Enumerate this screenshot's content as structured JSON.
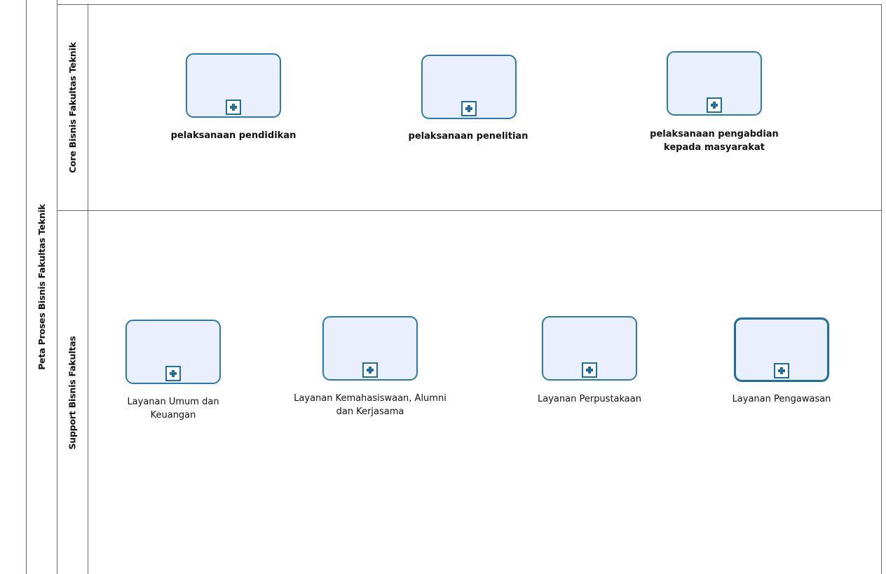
{
  "pool": {
    "title": "Peta Proses Bisnis Fakultas Teknik"
  },
  "lanes": [
    {
      "label": "Core Bisnis Fakultas Teknik",
      "tasks": [
        {
          "label_lines": [
            "pelaksanaan pendidikan"
          ]
        },
        {
          "label_lines": [
            "pelaksanaan penelitian"
          ]
        },
        {
          "label_lines": [
            "pelaksanaan pengabdian",
            "kepada masyarakat"
          ]
        }
      ]
    },
    {
      "label": "Support Bisnis Fakultas",
      "tasks": [
        {
          "label_lines": [
            "Layanan Umum dan",
            "Keuangan"
          ]
        },
        {
          "label_lines": [
            "Layanan Kemahasiswaan, Alumni",
            "dan Kerjasama"
          ]
        },
        {
          "label_lines": [
            "Layanan Perpustakaan"
          ]
        },
        {
          "label_lines": [
            "Layanan Pengawasan"
          ]
        }
      ]
    }
  ],
  "colors": {
    "task_border": "#2a7ab0",
    "task_fill": "#eaeffd",
    "marker": "#1f6d9e",
    "lines": "#6b6b6b"
  },
  "icons": {
    "subprocess_marker": "plus-square-icon"
  }
}
